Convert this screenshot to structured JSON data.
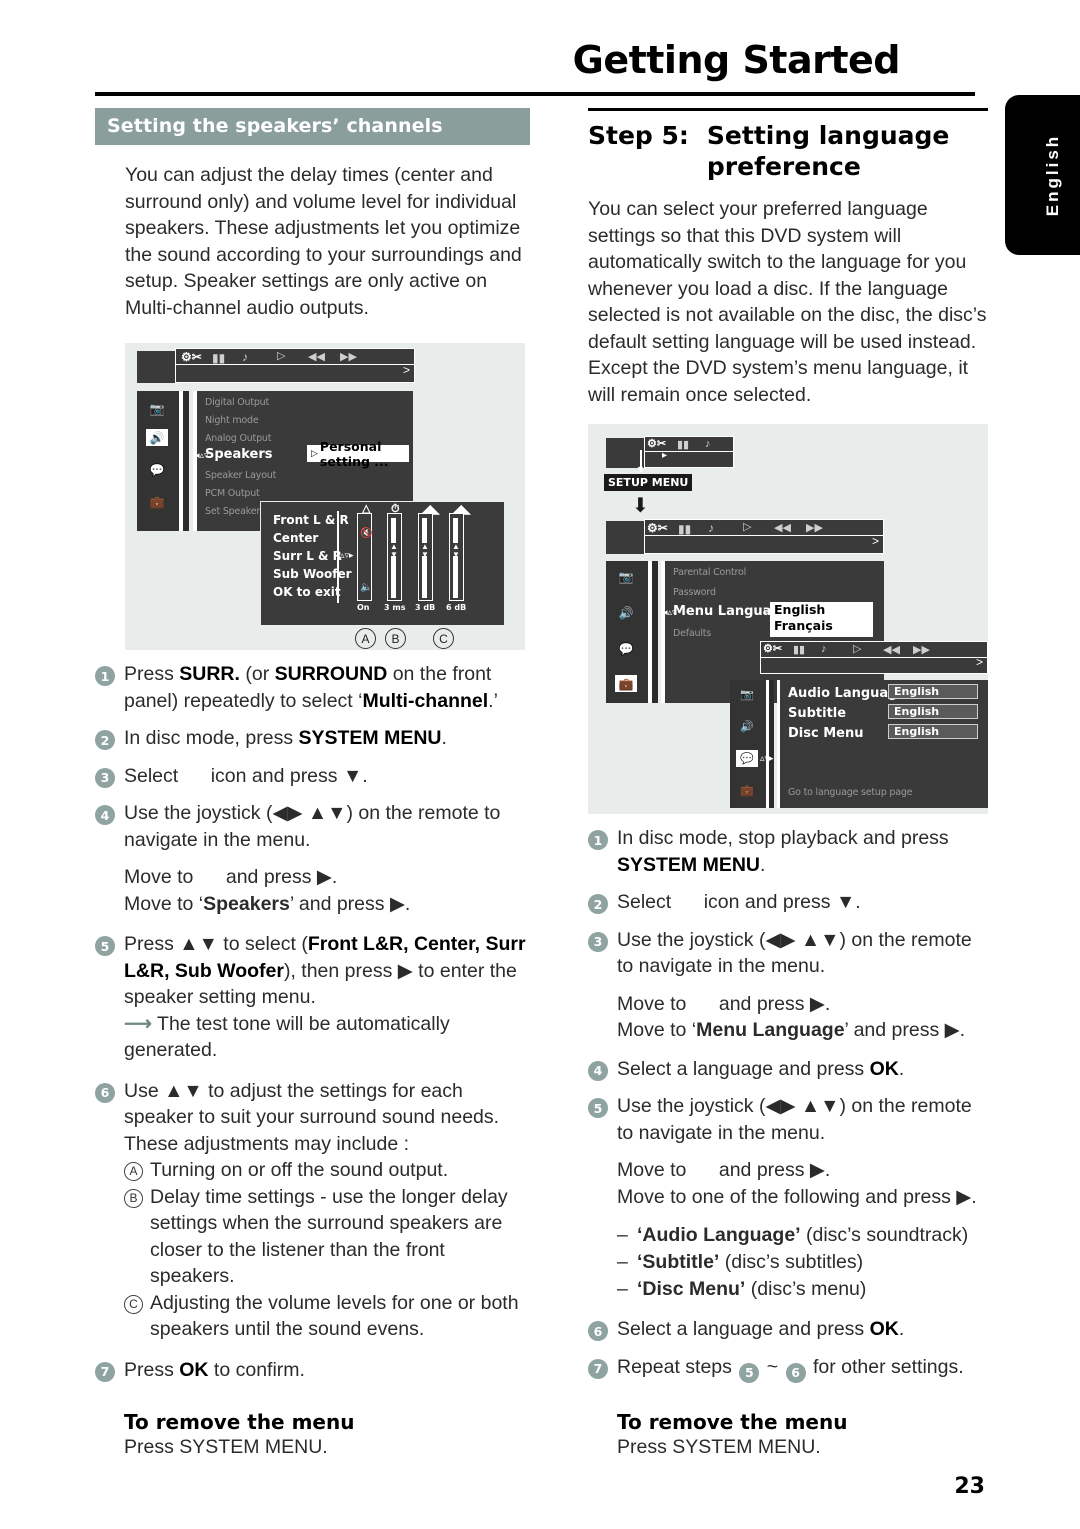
{
  "header": {
    "title": "Getting Started",
    "language_tab": "English",
    "page_number": "23"
  },
  "left": {
    "banner": "Setting the speakers’ channels",
    "intro": "You can adjust the delay times (center and surround only) and volume level for individual speakers.  These adjustments let you optimize the sound according to your surroundings and setup.  Speaker settings are only active on Multi-channel audio outputs.",
    "steps": [
      {
        "n": "1",
        "text_html": "Press <b>SURR.</b> (or <b>SURROUND</b> on the front panel) repeatedly to select ‘<b>Multi-channel</b>.’"
      },
      {
        "n": "2",
        "text_html": "In disc mode, press <b>SYSTEM MENU</b>."
      },
      {
        "n": "3",
        "text_html": "Select&nbsp;&nbsp;&nbsp;&nbsp;&nbsp;&nbsp;icon and press ▼."
      },
      {
        "n": "4",
        "text_html": "Use the joystick (◀▶ ▲▼) on the remote to navigate in the menu."
      }
    ],
    "sub_a": "Move to&nbsp;&nbsp;&nbsp;&nbsp;&nbsp;&nbsp;and press ▶.",
    "sub_b": "Move to ‘<b>Speakers</b>’ and press ▶.",
    "step5": "Press ▲▼ to select (<b>Front L&amp;R, Center, Surr L&amp;R, Sub Woofer</b>), then press ▶ to enter the speaker setting menu.",
    "step5_note": "The test tone will be automatically generated.",
    "step6": "Use ▲▼ to adjust the settings for each speaker to suit your surround sound needs.  These adjustments may include :",
    "abc": [
      {
        "letter": "A",
        "text": "Turning on or off the sound output."
      },
      {
        "letter": "B",
        "text": "Delay time settings - use the longer delay settings when the surround speakers are closer to the listener than the front speakers."
      },
      {
        "letter": "C",
        "text": "Adjusting the volume levels for one or both speakers until the sound evens."
      }
    ],
    "step7": "Press <b>OK</b> to confirm.",
    "remove_title": "To remove the menu",
    "remove_text": "Press SYSTEM MENU."
  },
  "right": {
    "step_label": "Step 5:",
    "step_title": "Setting language preference",
    "intro": "You can select your preferred language settings so that this DVD system will automatically switch to the language for you whenever you load a disc.  If the language selected is not available on the disc, the disc’s default setting language will be used instead.  Except the DVD system’s menu language, it will remain once selected.",
    "steps": [
      {
        "n": "1",
        "text_html": "In disc mode, stop playback and press <b>SYSTEM MENU</b>."
      },
      {
        "n": "2",
        "text_html": "Select&nbsp;&nbsp;&nbsp;&nbsp;&nbsp;&nbsp;icon and press ▼."
      },
      {
        "n": "3",
        "text_html": "Use the joystick (◀▶ ▲▼) on the remote to navigate in the menu."
      }
    ],
    "sub_a": "Move to&nbsp;&nbsp;&nbsp;&nbsp;&nbsp;&nbsp;and press ▶.",
    "sub_b": "Move to ‘<b>Menu Language</b>’ and press ▶.",
    "step4": "Select a language and press <b>OK</b>.",
    "step5": "Use the joystick (◀▶ ▲▼) on the remote to navigate in the menu.",
    "step5_sub_a": "Move to&nbsp;&nbsp;&nbsp;&nbsp;&nbsp;&nbsp;and press ▶.",
    "step5_sub_b": "Move to one of the following and press ▶.",
    "dashes": [
      {
        "bold": "‘Audio Language’",
        "rest": "(disc’s soundtrack)"
      },
      {
        "bold": "‘Subtitle’",
        "rest": "(disc’s subtitles)"
      },
      {
        "bold": "‘Disc Menu’",
        "rest": "(disc’s menu)"
      }
    ],
    "step6": "Select a language and press <b>OK</b>.",
    "step7_pre": "Repeat steps",
    "step7_a": "5",
    "step7_tilde": "~",
    "step7_b": "6",
    "step7_post": "for other settings.",
    "remove_title": "To remove the menu",
    "remove_text": "Press SYSTEM MENU."
  },
  "figure1": {
    "toolbar_icons": [
      "tools-icon",
      "tv-icon",
      "audio-icon",
      "play-icon",
      "rewind-icon",
      "forward-icon"
    ],
    "sidebar_icons": [
      "picture-icon",
      "speaker-icon",
      "subtitle-icon",
      "preferences-icon"
    ],
    "menu_items": [
      "Digital Output",
      "Night mode",
      "Analog Output",
      "Speakers",
      "Speaker Layout",
      "PCM Output",
      "Set  Speaker"
    ],
    "selected_item": "Speakers",
    "selected_value": "Personal setting ...",
    "popup_rows": [
      "Front L & R",
      "Center",
      "Surr L & R",
      "Sub Woofer",
      "OK to exit"
    ],
    "slider_values": [
      "On",
      "3 ms",
      "3 dB",
      "6 dB"
    ],
    "callouts": [
      "A",
      "B",
      "C"
    ]
  },
  "figure2": {
    "setup_tag": "SETUP MENU",
    "menu_items": [
      "Parental Control",
      "Password",
      "Menu Language",
      "Defaults"
    ],
    "selected_item": "Menu Language",
    "language_options": [
      "English",
      "Français"
    ],
    "lang_rows": [
      {
        "label": "Audio Language",
        "value": "English"
      },
      {
        "label": "Subtitle",
        "value": "English"
      },
      {
        "label": "Disc Menu",
        "value": "English"
      }
    ],
    "footer": "Go to language setup page"
  },
  "colors": {
    "banner": "#8a9e9b",
    "bullet": "#8fa3a0",
    "osd_bg": "#e8eceb",
    "osd_dark": "#3a3a3a"
  }
}
